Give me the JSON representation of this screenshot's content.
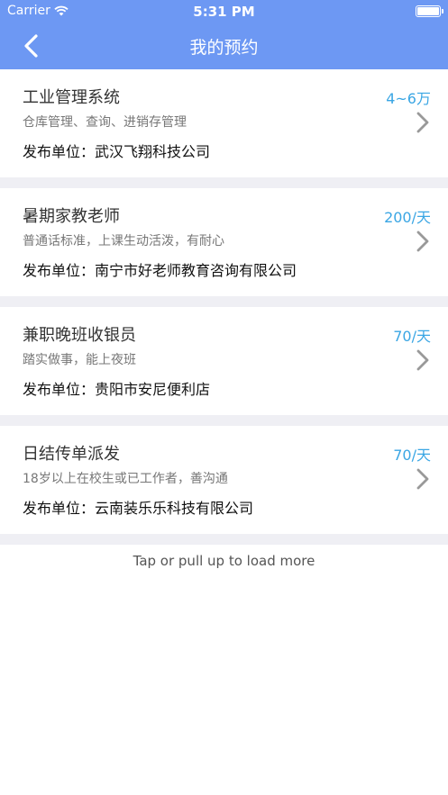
{
  "status_bar": {
    "carrier": "Carrier",
    "time": "5:31 PM"
  },
  "nav": {
    "title": "我的预约"
  },
  "jobs": [
    {
      "title": "工业管理系统",
      "description": "仓库管理、查询、进销存管理",
      "company": "发布单位：武汉飞翔科技公司",
      "salary": "4~6万"
    },
    {
      "title": "暑期家教老师",
      "description": "普通话标准，上课生动活泼，有耐心",
      "company": "发布单位：南宁市好老师教育咨询有限公司",
      "salary": "200/天"
    },
    {
      "title": "兼职晚班收银员",
      "description": "踏实做事，能上夜班",
      "company": "发布单位：贵阳市安尼便利店",
      "salary": "70/天"
    },
    {
      "title": "日结传单派发",
      "description": "18岁以上在校生或已工作者，善沟通",
      "company": "发布单位：云南装乐乐科技有限公司",
      "salary": "70/天"
    }
  ],
  "footer": {
    "load_more": "Tap or pull up to load more"
  },
  "colors": {
    "nav_bar": "#6d98f3",
    "salary": "#3aa6e4",
    "separator": "#efeff4"
  },
  "icons": {
    "back": "chevron-left-icon",
    "row_arrow": "chevron-right-icon",
    "wifi": "wifi-icon",
    "battery": "battery-icon"
  }
}
